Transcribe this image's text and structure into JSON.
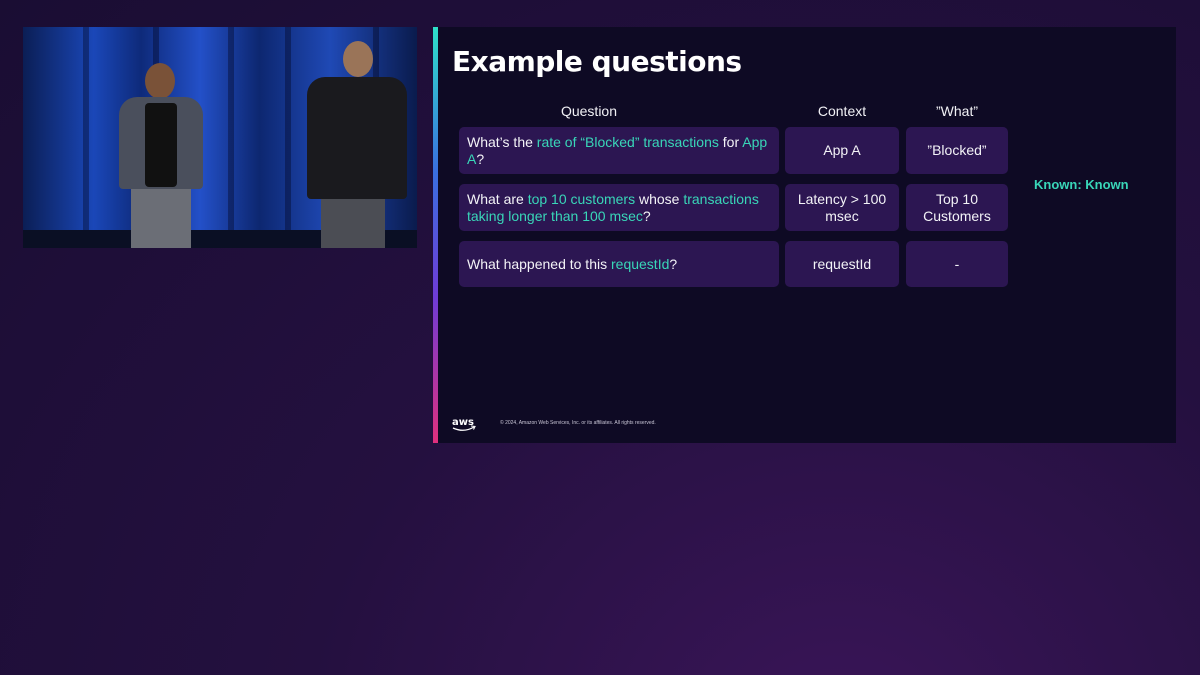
{
  "slide": {
    "title": "Example questions",
    "headers": {
      "question": "Question",
      "context": "Context",
      "what": "”What”"
    },
    "rows": [
      {
        "question": [
          {
            "text": "What’s the ",
            "hl": false
          },
          {
            "text": "rate of “Blocked” transactions",
            "hl": true
          },
          {
            "text": " for ",
            "hl": false
          },
          {
            "text": "App A",
            "hl": true
          },
          {
            "text": "?",
            "hl": false
          }
        ],
        "context": "App A",
        "what": "”Blocked”"
      },
      {
        "question": [
          {
            "text": "What are ",
            "hl": false
          },
          {
            "text": "top 10 customers",
            "hl": true
          },
          {
            "text": " whose ",
            "hl": false
          },
          {
            "text": "transactions taking longer than 100 msec",
            "hl": true
          },
          {
            "text": "?",
            "hl": false
          }
        ],
        "context": "Latency > 100 msec",
        "what": "Top 10 Customers"
      },
      {
        "question": [
          {
            "text": "What happened to this ",
            "hl": false
          },
          {
            "text": "requestId",
            "hl": true
          },
          {
            "text": "?",
            "hl": false
          }
        ],
        "context": "requestId",
        "what": "-"
      }
    ],
    "known_label": "Known: Known",
    "aws_logo_text": "aws",
    "copyright": "© 2024, Amazon Web Services, Inc. or its affiliates. All rights reserved.",
    "accent_color": "#39d6b8",
    "cell_bg": "#2c1652"
  },
  "video": {
    "icon": "speaker-video-feed"
  }
}
